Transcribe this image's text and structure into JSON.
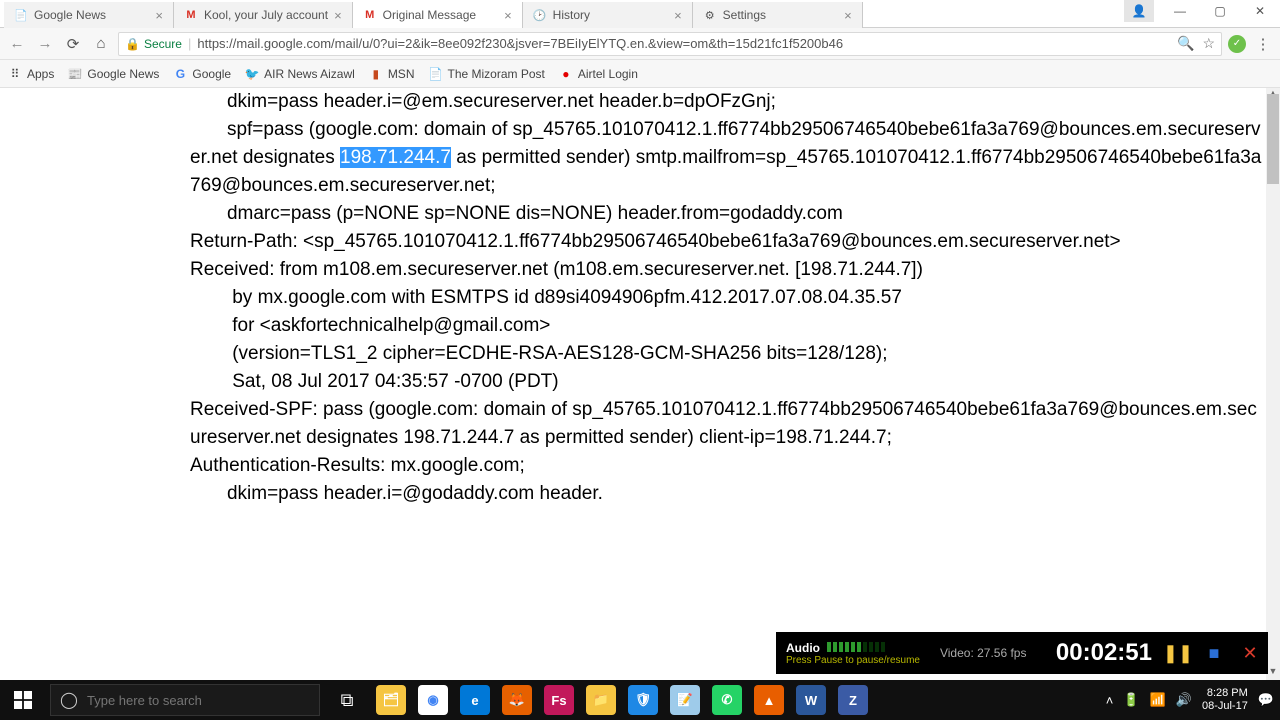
{
  "tabs": [
    {
      "title": "Google News",
      "icon": "📄"
    },
    {
      "title": "Kool, your July account",
      "icon": "M"
    },
    {
      "title": "Original Message",
      "icon": "M",
      "active": true
    },
    {
      "title": "History",
      "icon": "⏱"
    },
    {
      "title": "Settings",
      "icon": "⚙"
    }
  ],
  "address": {
    "secure_label": "Secure",
    "url": "https://mail.google.com/mail/u/0?ui=2&ik=8ee092f230&jsver=7BEiIyElYTQ.en.&view=om&th=15d21fc1f5200b46"
  },
  "bookmarks": [
    {
      "label": "Apps",
      "icon": "⠿"
    },
    {
      "label": "Google News",
      "icon": "📰"
    },
    {
      "label": "Google",
      "icon": "G"
    },
    {
      "label": "AIR News Aizawl",
      "icon": "🐦"
    },
    {
      "label": "MSN",
      "icon": "▮"
    },
    {
      "label": "The Mizoram Post",
      "icon": "📄"
    },
    {
      "label": "Airtel Login",
      "icon": "●"
    }
  ],
  "email_raw": {
    "pre_sel": "       dkim=pass header.i=@em.secureserver.net header.b=dpOFzGnj;\n       spf=pass (google.com: domain of sp_45765.101070412.1.ff6774bb29506746540bebe61fa3a769@bounces.em.secureserver.net designates ",
    "selected_ip": "198.71.244.7",
    "post_sel": " as permitted sender) smtp.mailfrom=sp_45765.101070412.1.ff6774bb29506746540bebe61fa3a769@bounces.em.secureserver.net;\n       dmarc=pass (p=NONE sp=NONE dis=NONE) header.from=godaddy.com\nReturn-Path: <sp_45765.101070412.1.ff6774bb29506746540bebe61fa3a769@bounces.em.secureserver.net>\nReceived: from m108.em.secureserver.net (m108.em.secureserver.net. [198.71.244.7])\n        by mx.google.com with ESMTPS id d89si4094906pfm.412.2017.07.08.04.35.57\n        for <askfortechnicalhelp@gmail.com>\n        (version=TLS1_2 cipher=ECDHE-RSA-AES128-GCM-SHA256 bits=128/128);\n        Sat, 08 Jul 2017 04:35:57 -0700 (PDT)\nReceived-SPF: pass (google.com: domain of sp_45765.101070412.1.ff6774bb29506746540bebe61fa3a769@bounces.em.secureserver.net designates 198.71.244.7 as permitted sender) client-ip=198.71.244.7;\nAuthentication-Results: mx.google.com;\n       dkim=pass header.i=@godaddy.com header."
  },
  "recorder": {
    "audio_label": "Audio",
    "video_label": "Video: 27.56 fps",
    "hint": "Press Pause to pause/resume",
    "time": "00:02:51"
  },
  "taskbar": {
    "search_placeholder": "Type here to search",
    "time": "8:28 PM",
    "date": "08-Jul-17"
  }
}
